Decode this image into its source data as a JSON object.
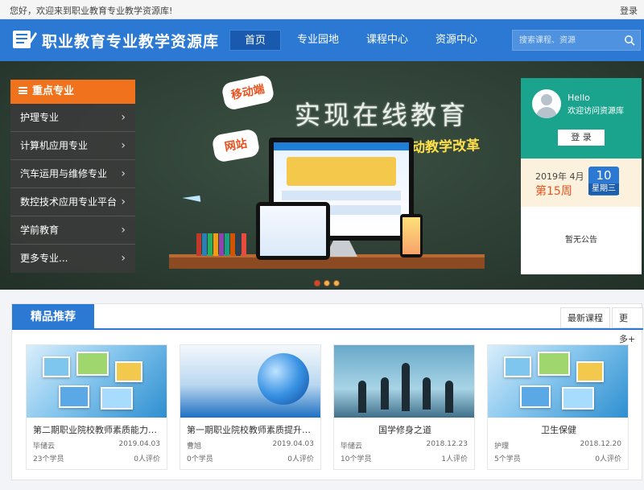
{
  "topbar": {
    "welcome": "您好，欢迎来到职业教育专业教学资源库!",
    "login": "登录"
  },
  "header": {
    "site_title": "职业教育专业教学资源库",
    "nav": [
      {
        "label": "首页",
        "active": true
      },
      {
        "label": "专业园地",
        "active": false
      },
      {
        "label": "课程中心",
        "active": false
      },
      {
        "label": "资源中心",
        "active": false
      }
    ],
    "search_placeholder": "搜索课程、资源"
  },
  "banner": {
    "headline": "实现在线教育",
    "subline": "推动教学改革",
    "bubble_left_top": "移动端",
    "bubble_left_mid": "网站",
    "slides_count": 3,
    "active_slide": 1
  },
  "sidebar": {
    "title": "重点专业",
    "items": [
      {
        "label": "护理专业"
      },
      {
        "label": "计算机应用专业"
      },
      {
        "label": "汽车运用与维修专业"
      },
      {
        "label": "数控技术应用专业平台"
      },
      {
        "label": "学前教育"
      },
      {
        "label": "更多专业..."
      }
    ]
  },
  "user_panel": {
    "hello": "Hello",
    "welcome": "欢迎访问资源库",
    "login_button": "登 录",
    "year_month": "2019年 4月",
    "week": "第15周",
    "day": "10",
    "weekday": "星期三",
    "notice": "暂无公告"
  },
  "featured": {
    "title": "精品推荐",
    "tab_latest": "最新课程",
    "tab_more": "更多+",
    "courses": [
      {
        "title": "第二期职业院校教师素质能力提...",
        "author": "毕储云",
        "date": "2019.04.03",
        "students": "23个学员",
        "reviews": "0人评价"
      },
      {
        "title": "第一期职业院校教师素质提升网...",
        "author": "曹旭",
        "date": "2019.04.03",
        "students": "0个学员",
        "reviews": "0人评价"
      },
      {
        "title": "国学修身之道",
        "author": "毕储云",
        "date": "2018.12.23",
        "students": "10个学员",
        "reviews": "1人评价"
      },
      {
        "title": "卫生保健",
        "author": "护理",
        "date": "2018.12.20",
        "students": "5个学员",
        "reviews": "0人评价"
      }
    ]
  },
  "colors": {
    "brand_blue": "#2c79d3",
    "sidebar_orange": "#f0721c",
    "panel_teal": "#1aa38d",
    "accent_orange": "#e9531f"
  }
}
